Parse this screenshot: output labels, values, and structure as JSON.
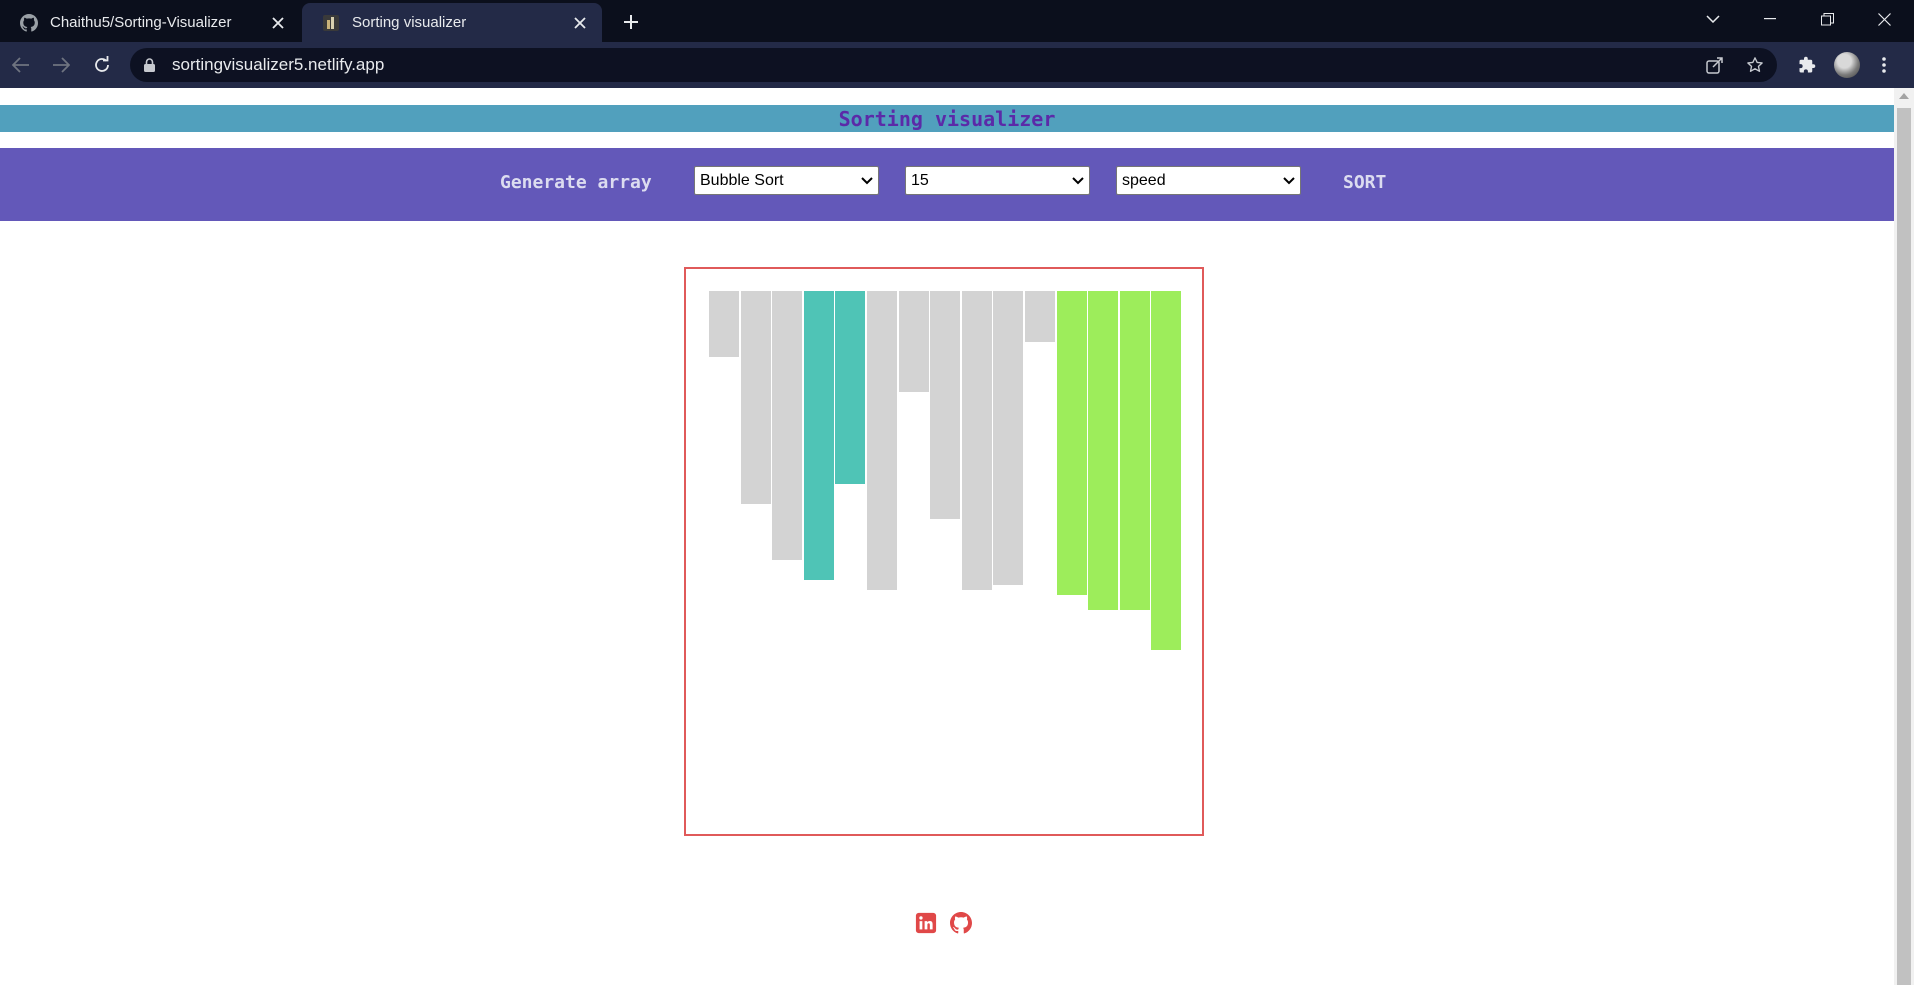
{
  "browser": {
    "tabs": [
      {
        "title": "Chaithu5/Sorting-Visualizer",
        "favicon": "github-icon",
        "active": false
      },
      {
        "title": "Sorting visualizer",
        "favicon": "site-icon",
        "active": true
      }
    ],
    "url": "sortingvisualizer5.netlify.app"
  },
  "app": {
    "title": "Sorting visualizer",
    "controls": {
      "generate_label": "Generate array",
      "algorithm": {
        "selected": "Bubble Sort"
      },
      "size": {
        "selected": "15"
      },
      "speed": {
        "selected": "speed"
      },
      "sort_label": "SORT"
    },
    "colors": {
      "default": "#d3d3d3",
      "comparing": "#4fc4b6",
      "sorted": "#9ded5b",
      "frame": "#e05a5a",
      "header": "#51a0bd",
      "controls": "#6358b9"
    },
    "array": [
      {
        "value": 66,
        "state": "default"
      },
      {
        "value": 213,
        "state": "default"
      },
      {
        "value": 269,
        "state": "default"
      },
      {
        "value": 289,
        "state": "comparing"
      },
      {
        "value": 193,
        "state": "comparing"
      },
      {
        "value": 299,
        "state": "default"
      },
      {
        "value": 101,
        "state": "default"
      },
      {
        "value": 228,
        "state": "default"
      },
      {
        "value": 299,
        "state": "default"
      },
      {
        "value": 294,
        "state": "default"
      },
      {
        "value": 51,
        "state": "default"
      },
      {
        "value": 304,
        "state": "sorted"
      },
      {
        "value": 319,
        "state": "sorted"
      },
      {
        "value": 319,
        "state": "sorted"
      },
      {
        "value": 359,
        "state": "sorted"
      }
    ],
    "footer": {
      "links": [
        {
          "icon": "linkedin-icon"
        },
        {
          "icon": "github-icon"
        }
      ]
    }
  }
}
